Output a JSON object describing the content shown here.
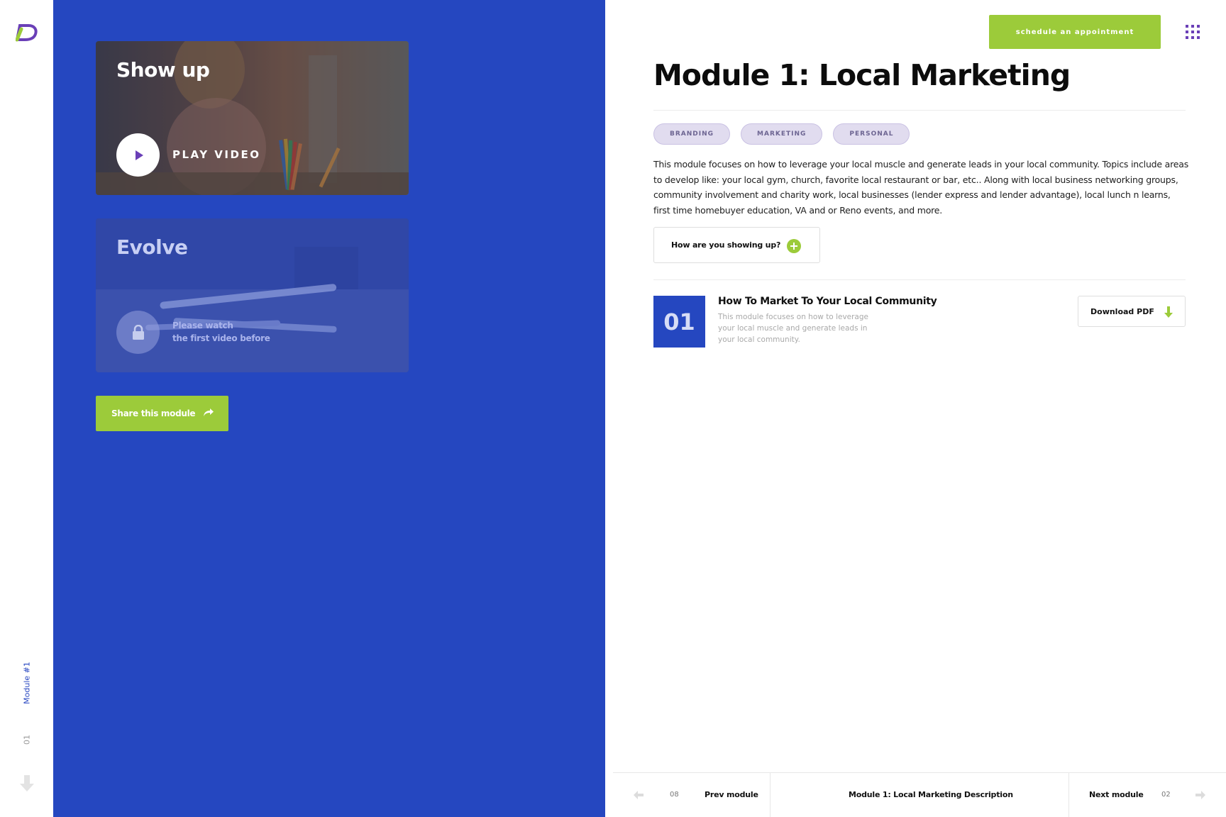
{
  "rail": {
    "module_label": "Module #1",
    "module_number": "01"
  },
  "cards": [
    {
      "title": "Show up",
      "action_label": "PLAY VIDEO",
      "locked": false
    },
    {
      "title": "Evolve",
      "locked": true,
      "lock_line1": "Please watch",
      "lock_line2": "the first video before"
    }
  ],
  "share": {
    "label": "Share this module"
  },
  "header": {
    "cta_label": "schedule an appointment",
    "menu_icon": "grid-icon"
  },
  "module": {
    "title": "Module 1: Local Marketing",
    "tags": [
      "BRANDING",
      "MARKETING",
      "PERSONAL"
    ],
    "description": "This module focuses on how to leverage your local muscle and generate leads in your local community. Topics include areas to develop like: your local gym, church, favorite local restaurant or bar, etc.. Along with local business networking groups, community involvement and charity work, local businesses (lender express and lender advantage), local lunch n learns, first time homebuyer education, VA and or Reno events, and more.",
    "question_label": "How are you showing up?"
  },
  "lessons": [
    {
      "number": "01",
      "title": "How To Market To Your Local Community",
      "description": "This module focuses on how to leverage your local muscle and generate leads in your local community.",
      "download_label": "Download PDF"
    }
  ],
  "footer": {
    "prev_number": "08",
    "prev_label": "Prev module",
    "center_label": "Module 1: Local Marketing Description",
    "next_label": "Next module",
    "next_number": "02"
  },
  "colors": {
    "primary_blue": "#2547c0",
    "accent_green": "#9ccb3a",
    "logo_purple": "#6a3fb7"
  }
}
